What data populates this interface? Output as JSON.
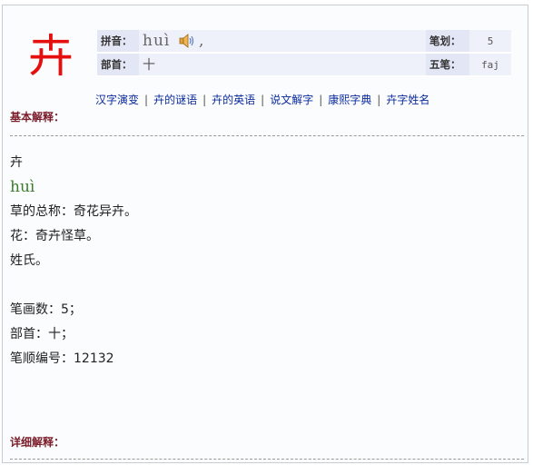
{
  "character": "卉",
  "info": {
    "pinyin_label": "拼音：",
    "pinyin_value": "huì",
    "pinyin_suffix": ",",
    "strokes_label": "笔划：",
    "strokes_value": "5",
    "radical_label": "部首：",
    "radical_value": "十",
    "wubi_label": "五笔：",
    "wubi_value": "faj",
    "speaker_icon": "speaker-icon"
  },
  "links": [
    "汉字演变",
    "卉的谜语",
    "卉的英语",
    "说文解字",
    "康熙字典",
    "卉字姓名"
  ],
  "basic_heading": "基本解释：",
  "basic": {
    "char": "卉",
    "pinyin": "huì",
    "def1": "草的总称：奇花异卉。",
    "def2": "花：奇卉怪草。",
    "def3": "姓氏。",
    "stroke_count": "笔画数：5；",
    "radical": "部首：十；",
    "stroke_order": "笔顺编号：12132"
  },
  "detail_heading": "详细解释："
}
